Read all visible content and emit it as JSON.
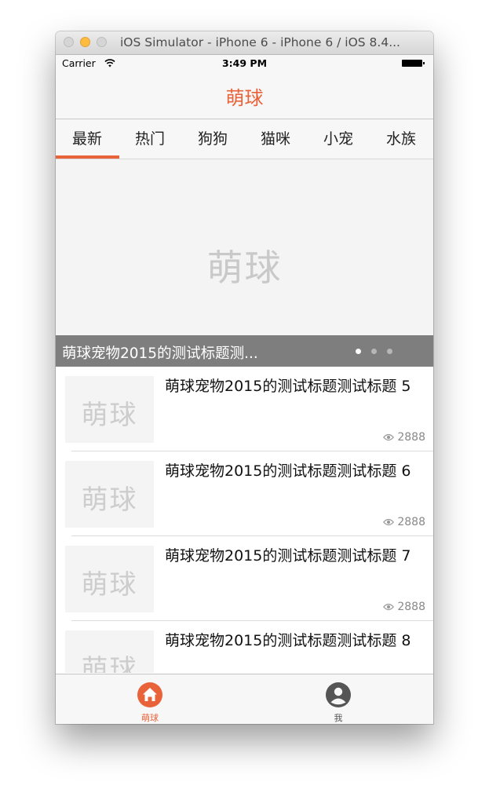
{
  "window": {
    "title": "iOS Simulator - iPhone 6 - iPhone 6 / iOS 8.4..."
  },
  "status_bar": {
    "carrier": "Carrier",
    "time": "3:49 PM"
  },
  "nav_bar": {
    "title": "萌球"
  },
  "tabs": [
    {
      "label": "最新",
      "active": true
    },
    {
      "label": "热门"
    },
    {
      "label": "狗狗"
    },
    {
      "label": "猫咪"
    },
    {
      "label": "小宠"
    },
    {
      "label": "水族"
    }
  ],
  "banner": {
    "placeholder_text": "萌球",
    "caption": "萌球宠物2015的测试标题测...",
    "page_count": 3,
    "active_page": 1
  },
  "placeholder_text": "萌球",
  "items": [
    {
      "title": "萌球宠物2015的测试标题测试标题 5",
      "views": "2888"
    },
    {
      "title": "萌球宠物2015的测试标题测试标题 6",
      "views": "2888"
    },
    {
      "title": "萌球宠物2015的测试标题测试标题 7",
      "views": "2888"
    },
    {
      "title": "萌球宠物2015的测试标题测试标题 8",
      "views": ""
    }
  ],
  "tab_bar": [
    {
      "label": "萌球",
      "icon": "home-icon",
      "active": true
    },
    {
      "label": "我",
      "icon": "profile-icon",
      "active": false
    }
  ],
  "colors": {
    "accent": "#e8633a",
    "inactive": "#555555",
    "caption_bg": "#7e7e7e"
  }
}
